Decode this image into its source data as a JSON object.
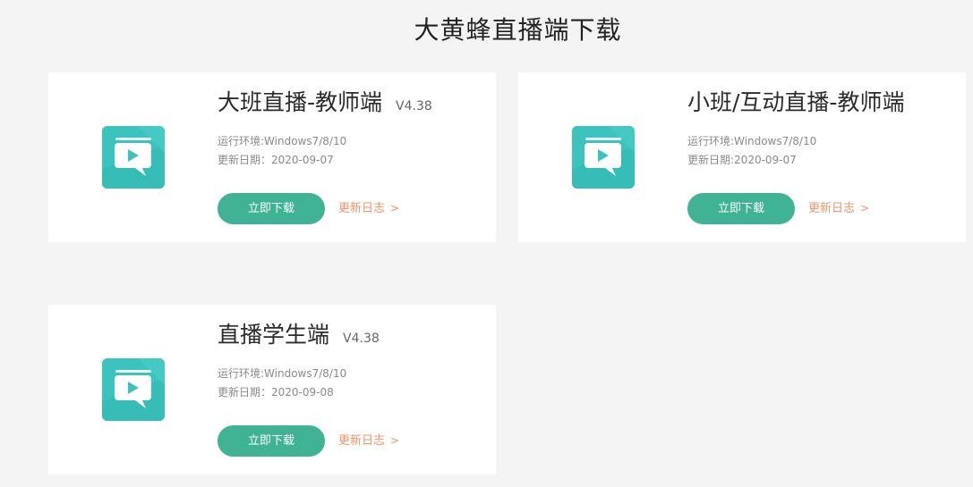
{
  "page": {
    "title": "大黄蜂直播端下载"
  },
  "colors": {
    "background": "#f4f4f4",
    "card": "#ffffff",
    "download_button": "#3fb393",
    "changelog_link": "#f0956a",
    "icon_teal": "#3cc2bd"
  },
  "cards": [
    {
      "name": "大班直播-教师端",
      "version": "V4.38",
      "env": "运行环境:Windows7/8/10",
      "date": "更新日期：2020-09-07",
      "download_label": "立即下载",
      "changelog_label": "更新日志",
      "changelog_arrow": ">",
      "icon": "play-bubble-icon"
    },
    {
      "name": "小班/互动直播-教师端",
      "version": "",
      "env": "运行环境:Windows7/8/10",
      "date": "更新日期:2020-09-07",
      "download_label": "立即下载",
      "changelog_label": "更新日志",
      "changelog_arrow": ">",
      "icon": "play-bubble-icon"
    },
    {
      "name": "直播学生端",
      "version": "V4.38",
      "env": "运行环境:Windows7/8/10",
      "date": "更新日期：2020-09-08",
      "download_label": "立即下载",
      "changelog_label": "更新日志",
      "changelog_arrow": ">",
      "icon": "play-bubble-icon"
    }
  ]
}
